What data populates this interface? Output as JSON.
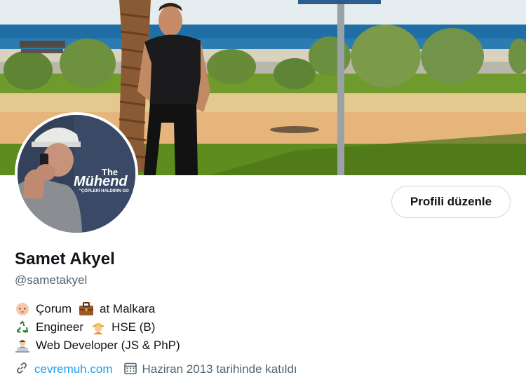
{
  "profile": {
    "name": "Samet Akyel",
    "handle": "@sametakyel",
    "edit_button": "Profili düzenle",
    "bio": {
      "line1_a": "Çorum",
      "line1_b": "at Malkara",
      "line2_a": "Engineer",
      "line2_b": "HSE (B)",
      "line3": "Web Developer (JS & PhP)"
    },
    "website": "cevremuh.com",
    "joined": "Haziran 2013 tarihinde katıldı"
  },
  "avatar_caption": {
    "title": "The",
    "brand": "Mühend",
    "tagline": "\"ÇÖPLERİ HALDIRIN GO"
  },
  "icons": {
    "line1_a": "baby-face-icon",
    "line1_b": "briefcase-icon",
    "line2_a": "recycle-icon",
    "line2_b": "construction-worker-icon",
    "line3": "technologist-icon",
    "website": "link-icon",
    "joined": "calendar-icon"
  },
  "colors": {
    "accent": "#1d9bf0",
    "secondary_text": "#536471",
    "border": "#cfd9de"
  }
}
